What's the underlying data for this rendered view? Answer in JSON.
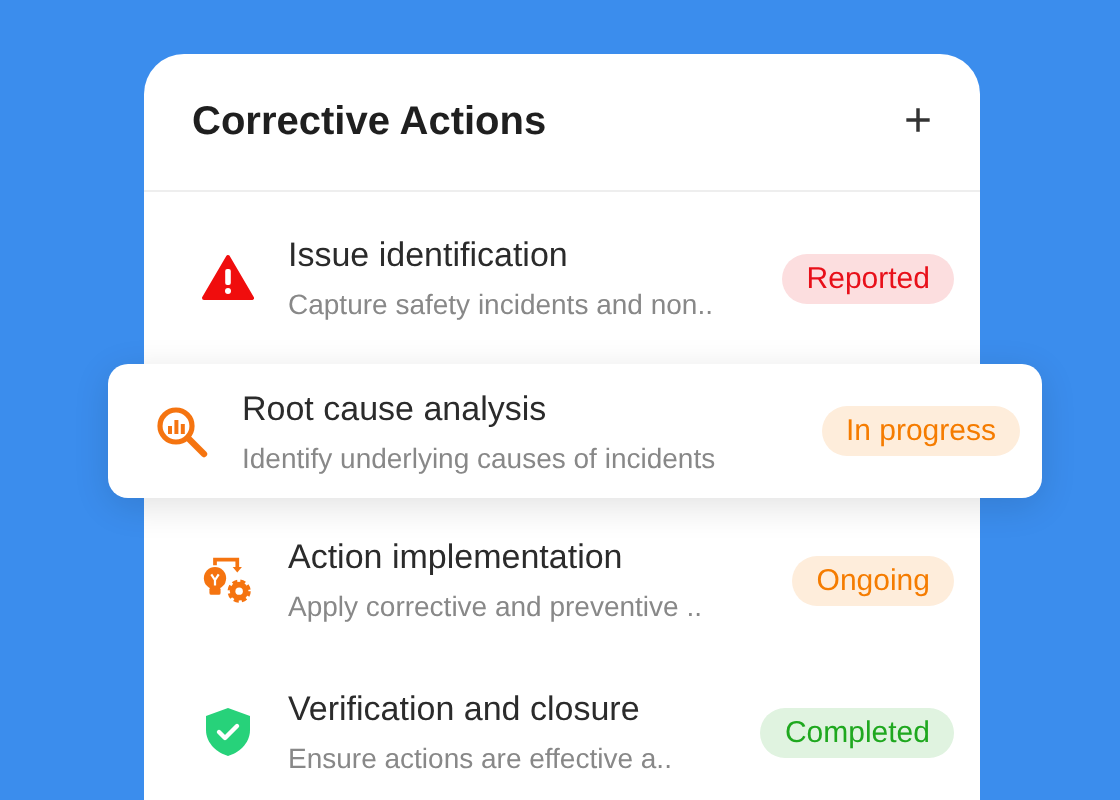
{
  "card": {
    "title": "Corrective Actions",
    "add_button": "+"
  },
  "actions": [
    {
      "kind": "warning",
      "title": "Issue identification",
      "description": "Capture safety incidents and non..",
      "status": "Reported",
      "color": "#e8101a",
      "selected": false
    },
    {
      "kind": "analysis",
      "title": "Root cause analysis",
      "description": "Identify underlying causes of incidents",
      "status": "In progress",
      "color": "#f57c00",
      "selected": true
    },
    {
      "kind": "implement",
      "title": "Action implementation",
      "description": "Apply corrective and preventive ..",
      "status": "Ongoing",
      "color": "#f57c00",
      "selected": false
    },
    {
      "kind": "shield",
      "title": "Verification and closure",
      "description": "Ensure actions are effective a..",
      "status": "Completed",
      "color": "#1fa81f",
      "selected": false
    }
  ]
}
